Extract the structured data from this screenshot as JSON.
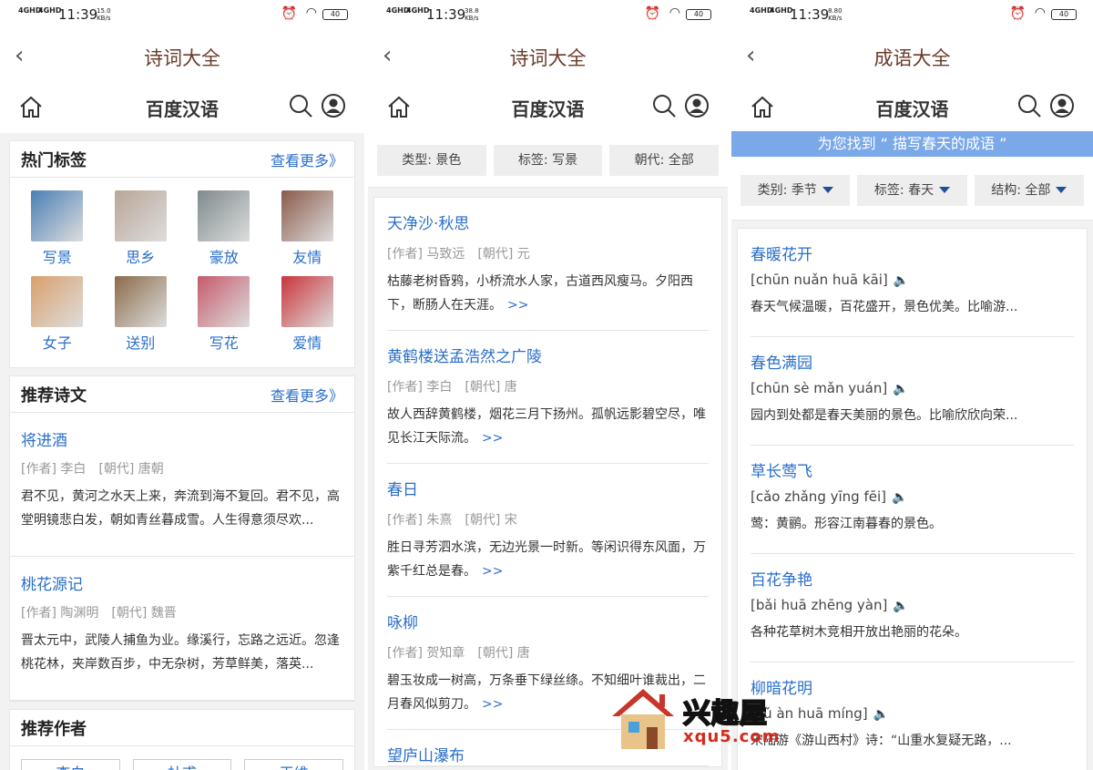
{
  "status": [
    {
      "sig1": "4GHD",
      "sig2": "4GHD",
      "time": "11:39",
      "speed_top": "15.0",
      "speed_unit": "KB/s",
      "battery": "40"
    },
    {
      "sig1": "4GHD",
      "sig2": "4GHD",
      "time": "11:39",
      "speed_top": "38.8",
      "speed_unit": "KB/s",
      "battery": "40"
    },
    {
      "sig1": "4GHD",
      "sig2": "4GHD",
      "time": "11:39",
      "speed_top": "8.80",
      "speed_unit": "KB/s",
      "battery": "40"
    }
  ],
  "brand": "百度汉语",
  "panel1": {
    "title": "诗词大全",
    "hot_tags": {
      "heading": "热门标签",
      "more": "查看更多》",
      "items": [
        {
          "label": "写景",
          "color": "#4a7fb5"
        },
        {
          "label": "思乡",
          "color": "#b9a596"
        },
        {
          "label": "豪放",
          "color": "#7f8a8c"
        },
        {
          "label": "友情",
          "color": "#8a5a4a"
        },
        {
          "label": "女子",
          "color": "#d9a06c"
        },
        {
          "label": "送别",
          "color": "#8b6b4a"
        },
        {
          "label": "写花",
          "color": "#c65a6a"
        },
        {
          "label": "爱情",
          "color": "#c9343a"
        }
      ]
    },
    "recommend": {
      "heading": "推荐诗文",
      "more": "查看更多》",
      "poems": [
        {
          "title": "将进酒",
          "author": "[作者] 李白",
          "dynasty": "[朝代] 唐朝",
          "body": "君不见，黄河之水天上来，奔流到海不复回。君不见，高堂明镜悲白发，朝如青丝暮成雪。人生得意须尽欢..."
        },
        {
          "title": "桃花源记",
          "author": "[作者] 陶渊明",
          "dynasty": "[朝代] 魏晋",
          "body": "晋太元中，武陵人捕鱼为业。缘溪行，忘路之远近。忽逢桃花林，夹岸数百步，中无杂树，芳草鲜美，落英..."
        }
      ]
    },
    "authors": {
      "heading": "推荐作者",
      "items": [
        "李白",
        "杜甫",
        "王维"
      ]
    }
  },
  "panel2": {
    "title": "诗词大全",
    "filters": [
      "类型: 景色",
      "标签: 写景",
      "朝代: 全部"
    ],
    "items": [
      {
        "title": "天净沙·秋思",
        "author": "[作者] 马致远",
        "dynasty": "[朝代] 元",
        "body": "枯藤老树昏鸦，小桥流水人家，古道西风瘦马。夕阳西下，断肠人在天涯。"
      },
      {
        "title": "黄鹤楼送孟浩然之广陵",
        "author": "[作者] 李白",
        "dynasty": "[朝代] 唐",
        "body": "故人西辞黄鹤楼，烟花三月下扬州。孤帆远影碧空尽，唯见长江天际流。"
      },
      {
        "title": "春日",
        "author": "[作者] 朱熹",
        "dynasty": "[朝代] 宋",
        "body": "胜日寻芳泗水滨，无边光景一时新。等闲识得东风面，万紫千红总是春。"
      },
      {
        "title": "咏柳",
        "author": "[作者] 贺知章",
        "dynasty": "[朝代] 唐",
        "body": "碧玉妆成一树高，万条垂下绿丝绦。不知细叶谁裁出，二月春风似剪刀。"
      },
      {
        "title": "望庐山瀑布",
        "author": "",
        "dynasty": "",
        "body": ""
      }
    ],
    "arrow": ">>"
  },
  "panel3": {
    "title": "成语大全",
    "banner": "为您找到 “ 描写春天的成语 ”",
    "filters": [
      "类别: 季节",
      "标签: 春天",
      "结构: 全部"
    ],
    "items": [
      {
        "title": "春暖花开",
        "pinyin": "[chūn nuǎn huā kāi]",
        "def": "春天气候温暖，百花盛开，景色优美。比喻游..."
      },
      {
        "title": "春色满园",
        "pinyin": "[chūn sè mǎn yuán]",
        "def": "园内到处都是春天美丽的景色。比喻欣欣向荣..."
      },
      {
        "title": "草长莺飞",
        "pinyin": "[cǎo zhǎng yīng fēi]",
        "def": "莺：黄鹂。形容江南暮春的景色。"
      },
      {
        "title": "百花争艳",
        "pinyin": "[bǎi huā zhēng yàn]",
        "def": "各种花草树木竞相开放出艳丽的花朵。"
      },
      {
        "title": "柳暗花明",
        "pinyin": "[liǔ àn huā míng]",
        "def": "宋陆游《游山西村》诗：“山重水复疑无路，..."
      }
    ]
  },
  "watermark": {
    "name": "兴趣屋",
    "url": "xqu5.com"
  }
}
